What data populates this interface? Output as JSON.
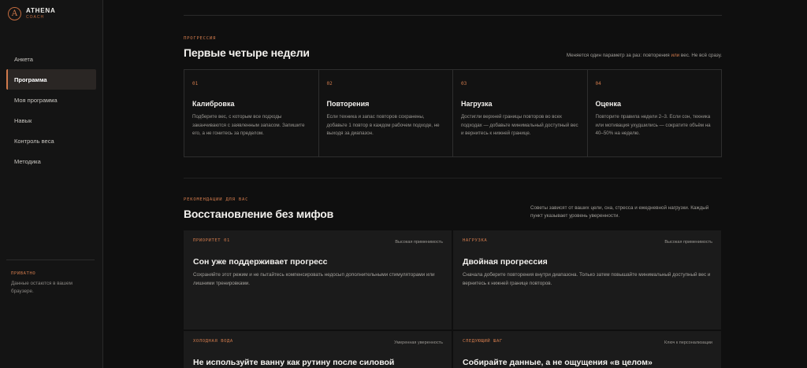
{
  "brand": {
    "mark": "A",
    "name": "ATHENA",
    "sub": "COACH"
  },
  "nav": [
    {
      "label": "Анкета",
      "active": false
    },
    {
      "label": "Программа",
      "active": true
    },
    {
      "label": "Моя программа",
      "active": false
    },
    {
      "label": "Навык",
      "active": false
    },
    {
      "label": "Контроль веса",
      "active": false
    },
    {
      "label": "Методика",
      "active": false
    }
  ],
  "privacy": {
    "label": "ПРИВАТНО",
    "text": "Данные остаются в вашем браузере."
  },
  "progression": {
    "kicker": "ПРОГРЕССИЯ",
    "title": "Первые четыре недели",
    "note_before": "Меняется один параметр за раз: повторения ",
    "note_accent": "или",
    "note_after": " вес. Не всё сразу.",
    "steps": [
      {
        "num": "01",
        "title": "Калибровка",
        "text": "Подберите вес, с которым все подходы заканчиваются с заявленным запасом. Запишите его, а не гонитесь за пределом."
      },
      {
        "num": "02",
        "title": "Повторения",
        "text": "Если техника и запас повторов сохранены, добавьте 1 повтор в каждом рабочем подходе, не выходя за диапазон."
      },
      {
        "num": "03",
        "title": "Нагрузка",
        "text": "Достигли верхней границы повторов во всех подходах — добавьте минимальный доступный вес и вернитесь к нижней границе."
      },
      {
        "num": "04",
        "title": "Оценка",
        "text": "Повторите правила недели 2–3. Если сон, техника или мотивация ухудшились — сократите объём на 40–50% на неделю."
      }
    ]
  },
  "recovery": {
    "kicker": "РЕКОМЕНДАЦИИ ДЛЯ ВАС",
    "title": "Восстановление без мифов",
    "note": "Советы зависят от ваших цели, сна, стресса и ежедневной нагрузки. Каждый пункт указывает уровень уверенности.",
    "cards": [
      {
        "kicker": "ПРИОРИТЕТ 01",
        "meta": "Высокая применимость",
        "title": "Сон уже поддерживает прогресс",
        "text": "Сохраняйте этот режим и не пытайтесь компенсировать недосып дополнительными стимуляторами или лишними тренировками."
      },
      {
        "kicker": "НАГРУЗКА",
        "meta": "Высокая применимость",
        "title": "Двойная прогрессия",
        "text": "Сначала доберите повторения внутри диапазона. Только затем повышайте минимальный доступный вес и вернитесь к нижней границе повторов."
      },
      {
        "kicker": "ХОЛОДНАЯ ВОДА",
        "meta": "Умеренная уверенность",
        "title": "Не используйте ванну как рутину после силовой",
        "text": ""
      },
      {
        "kicker": "СЛЕДУЮЩИЙ ШАГ",
        "meta": "Ключ к персонализации",
        "title": "Собирайте данные, а не ощущения «в целом»",
        "text": ""
      }
    ]
  },
  "colors": {
    "accent": "#d07a4c",
    "bg": "#0f0f0f",
    "sidebar": "#141414",
    "card": "#1b1b1b"
  }
}
